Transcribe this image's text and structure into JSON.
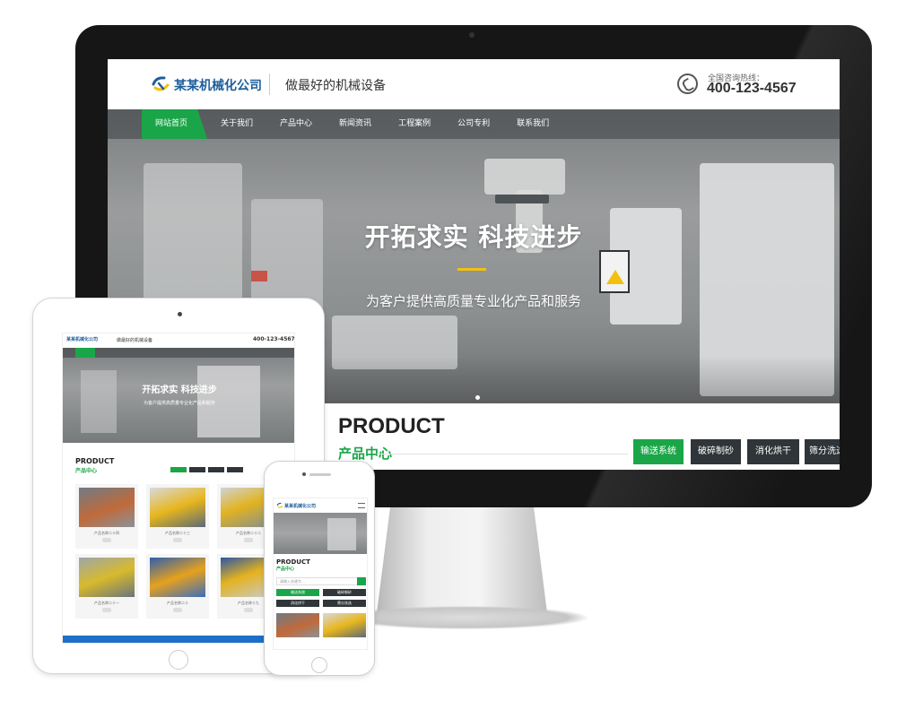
{
  "company": {
    "name": "某某机械化公司",
    "slogan": "做最好的机械设备",
    "hotline_label": "全国咨询热线：",
    "hotline_number": "400-123-4567",
    "brand_blue": "#1d5f9b",
    "accent_green": "#1aa648"
  },
  "nav": {
    "items": [
      "网站首页",
      "关于我们",
      "产品中心",
      "新闻资讯",
      "工程案例",
      "公司专利",
      "联系我们"
    ],
    "active_index": 0
  },
  "hero": {
    "title": "开拓求实 科技进步",
    "subtitle": "为客户提供高质量专业化产品和服务",
    "accent_bar_color": "#f3c010"
  },
  "products": {
    "heading_en": "PRODUCT",
    "heading_cn": "产品中心",
    "tabs": [
      "输送系统",
      "破碎制砂",
      "消化烘干",
      "筛分洗选"
    ],
    "active_tab": 0
  },
  "tablet": {
    "product_captions": [
      "产品名称二十四",
      "产品名称二十三",
      "产品名称二十二",
      "产品名称二十一",
      "产品名称二十",
      "产品名称十九"
    ]
  },
  "phone": {
    "search_placeholder": "请输入关键字...",
    "tabs": [
      "输送系统",
      "破碎制砂",
      "消化烘干",
      "筛分洗选"
    ]
  }
}
